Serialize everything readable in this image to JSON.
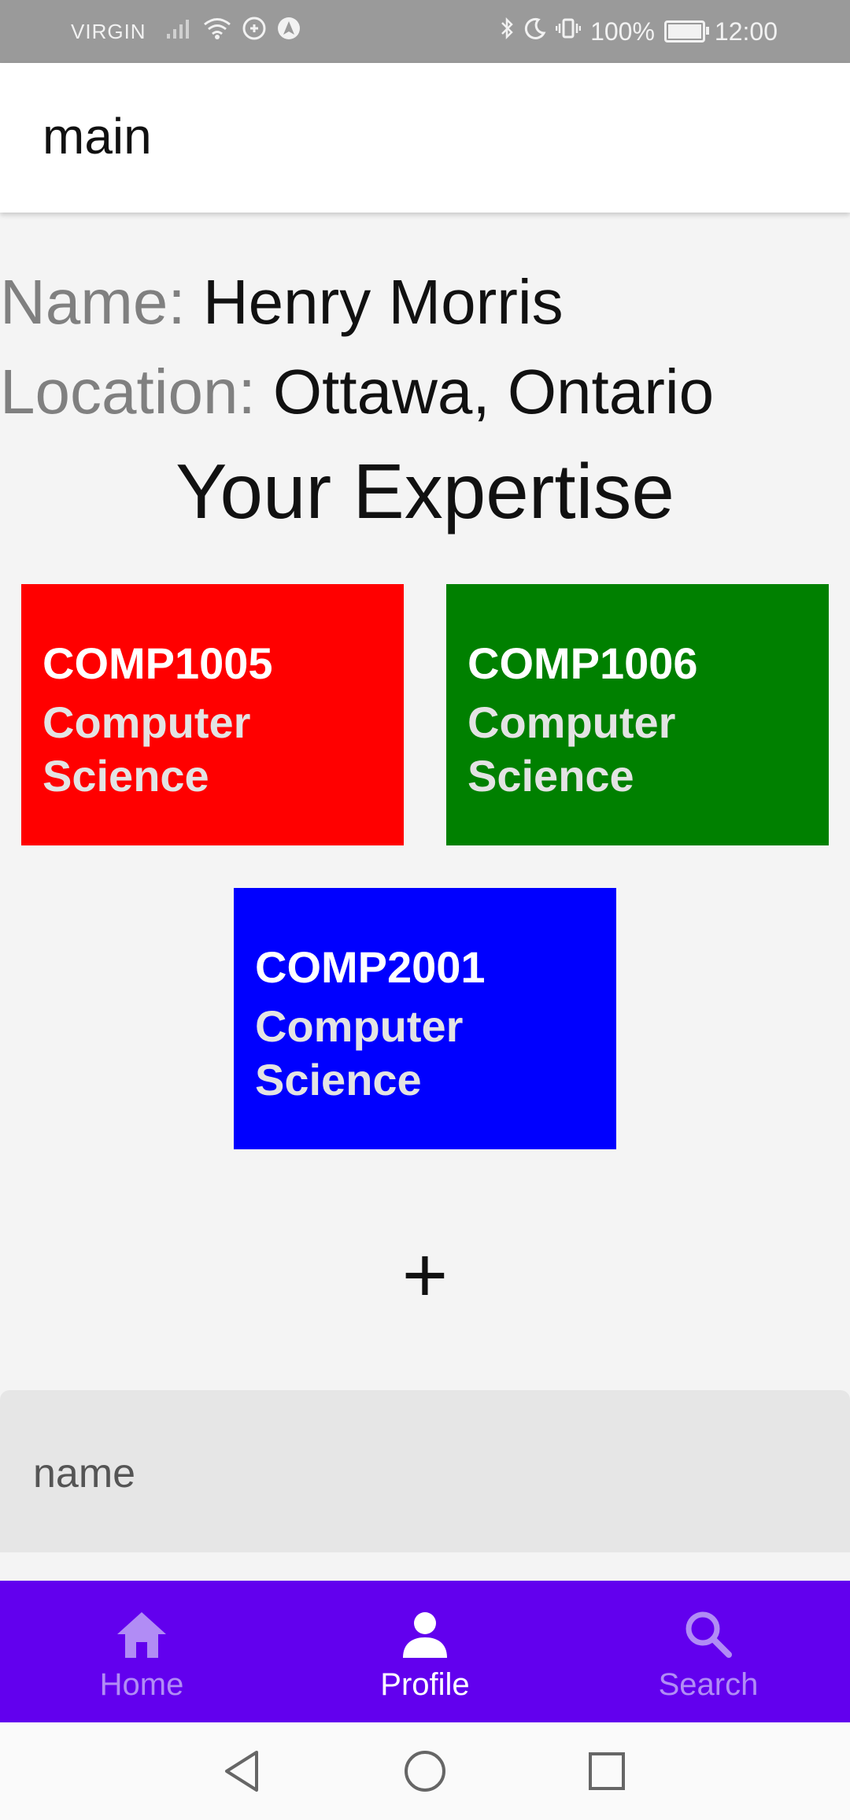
{
  "status_bar": {
    "carrier": "VIRGIN",
    "battery": "100%",
    "time": "12:00"
  },
  "app_bar": {
    "title": "main"
  },
  "profile": {
    "name_label": "Name:",
    "name_value": "Henry Morris",
    "location_label": "Location:",
    "location_value": "Ottawa, Ontario"
  },
  "expertise": {
    "heading": "Your Expertise",
    "cards": [
      {
        "code": "COMP1005",
        "subject": "Computer Science",
        "color": "#ff0000"
      },
      {
        "code": "COMP1006",
        "subject": "Computer Science",
        "color": "#008000"
      },
      {
        "code": "COMP2001",
        "subject": "Computer Science",
        "color": "#0000ff"
      }
    ],
    "add_label": "+"
  },
  "name_input": {
    "placeholder": "name"
  },
  "bottom_nav": {
    "items": [
      {
        "label": "Home",
        "icon": "home-icon"
      },
      {
        "label": "Profile",
        "icon": "person-icon",
        "active": true
      },
      {
        "label": "Search",
        "icon": "search-icon"
      }
    ],
    "background": "#6200ee"
  },
  "system_nav": {
    "icons": [
      "back-icon",
      "home-circle-icon",
      "recents-icon"
    ]
  }
}
